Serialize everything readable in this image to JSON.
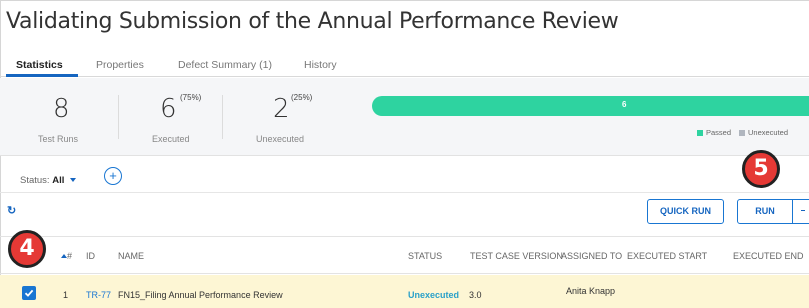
{
  "page": {
    "title": "Validating Submission of the Annual Performance Review"
  },
  "tabs": [
    {
      "label": "Statistics",
      "active": true
    },
    {
      "label": "Properties",
      "active": false
    },
    {
      "label": "Defect Summary (1)",
      "active": false
    },
    {
      "label": "History",
      "active": false
    }
  ],
  "stats": {
    "test_runs": {
      "value": "8",
      "label": "Test Runs"
    },
    "executed": {
      "value": "6",
      "percent": "(75%)",
      "label": "Executed"
    },
    "unexecuted": {
      "value": "2",
      "percent": "(25%)",
      "label": "Unexecuted"
    }
  },
  "progress": {
    "passed_count": "6",
    "passed_fraction": 1.0,
    "legend": [
      {
        "label": "Passed",
        "color": "#2ed3a0"
      },
      {
        "label": "Unexecuted",
        "color": "#b0b6bf"
      }
    ]
  },
  "filter": {
    "status_prefix": "Status:",
    "status_value": "All"
  },
  "toolbar": {
    "refresh_icon": "refresh-icon",
    "quick_run_label": "QUICK RUN",
    "run_label": "RUN"
  },
  "table": {
    "headers": {
      "num": "#",
      "id": "ID",
      "name": "NAME",
      "status": "STATUS",
      "version": "TEST CASE VERSION",
      "assigned": "ASSIGNED TO",
      "start": "EXECUTED START",
      "end": "EXECUTED END"
    },
    "rows": [
      {
        "checked": true,
        "num": "1",
        "id": "TR-77",
        "name": "FN15_Filing Annual Performance Review",
        "status": "Unexecuted",
        "version": "3.0",
        "assigned": "Anita Knapp"
      }
    ]
  },
  "annotations": {
    "step_4": "4",
    "step_5": "5"
  },
  "colors": {
    "accent": "#1976d2",
    "passed": "#2ed3a0",
    "row_highlight": "#fdf6d4",
    "badge": "#e53935"
  }
}
